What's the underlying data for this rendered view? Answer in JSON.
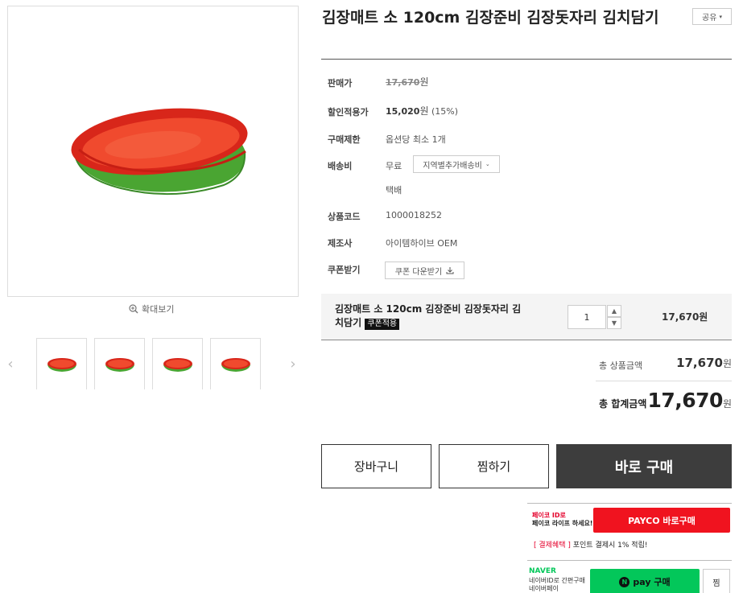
{
  "product": {
    "title": "김장매트 소 120cm 김장준비 김장돗자리 김치담기",
    "share_label": "공유"
  },
  "gallery": {
    "zoom_label": "확대보기",
    "thumbnail_count": 4
  },
  "info": {
    "price_label": "판매가",
    "price_value": "17,670",
    "won": "원",
    "sale_label": "할인적용가",
    "sale_value": "15,020",
    "sale_percent": "(15%)",
    "limit_label": "구매제한",
    "limit_value": "옵션당 최소 1개",
    "shipping_label": "배송비",
    "shipping_value": "무료",
    "region_button": "지역별추가배송비",
    "shipping_method": "택배",
    "code_label": "상품코드",
    "code_value": "1000018252",
    "maker_label": "제조사",
    "maker_value": "아이템하이브 OEM",
    "coupon_label": "쿠폰받기",
    "coupon_button": "쿠폰 다운받기"
  },
  "option": {
    "name": "김장매트 소 120cm 김장준비 김장돗자리 김치담기",
    "coupon_tag": "쿠폰적용",
    "quantity": "1",
    "price": "17,670원"
  },
  "totals": {
    "product_total_label": "총 상품금액",
    "product_total_value": "17,670",
    "grand_total_label": "총 합계금액",
    "grand_total_value": "17,670",
    "won": "원"
  },
  "buttons": {
    "cart": "장바구니",
    "wish": "찜하기",
    "buy": "바로 구매"
  },
  "payco": {
    "note_line1": "페이코 ID로",
    "note_line2": "페이코 라이프 하세요!",
    "button": "PAYCO 바로구매",
    "benefit_tag": "[ 결제혜택 ]",
    "benefit_text": "포인트 결제시 1% 적립!"
  },
  "naver": {
    "brand": "NAVER",
    "note_line1": "네이버ID로 간편구매",
    "note_line2": "네이버페이",
    "pay_label": "pay 구매",
    "zzim": "찜"
  },
  "colors": {
    "buy_button": "#3d3d3d",
    "payco_red": "#f0131f",
    "naver_green": "#03c75a",
    "mat_red": "#e8321e",
    "mat_green": "#4aa532"
  }
}
